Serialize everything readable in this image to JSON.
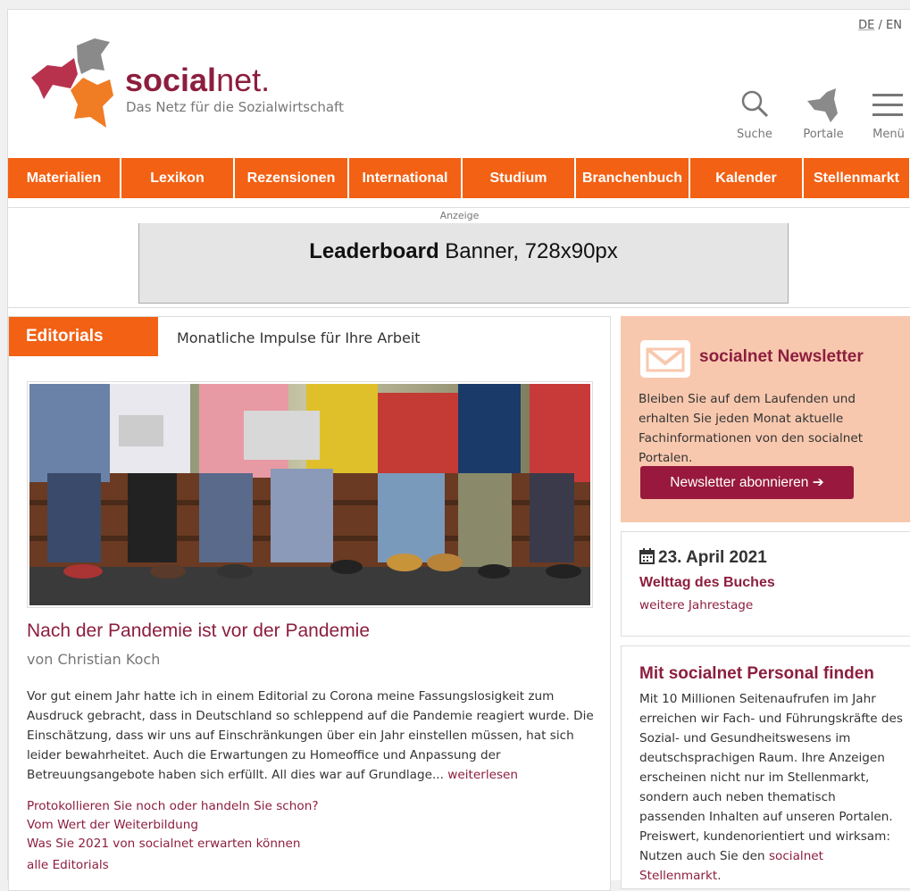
{
  "header": {
    "lang_de": "DE",
    "lang_sep": " / ",
    "lang_en": "EN",
    "brand_social": "social",
    "brand_net": "net.",
    "tagline": "Das Netz für die Sozialwirtschaft",
    "search_label": "Suche",
    "portals_label": "Portale",
    "menu_label": "Menü"
  },
  "nav": {
    "items": [
      "Materialien",
      "Lexikon",
      "Rezensionen",
      "International",
      "Studium",
      "Branchenbuch",
      "Kalender",
      "Stellenmarkt"
    ]
  },
  "ad": {
    "label": "Anzeige",
    "banner_bold": "Leaderboard",
    "banner_rest": " Banner, 728x90px"
  },
  "editorials": {
    "tab": "Editorials",
    "subtitle": "Monatliche Impulse für Ihre Arbeit",
    "title": "Nach der Pandemie ist vor der Pandemie",
    "author": "von Christian Koch",
    "body": "Vor gut einem Jahr hatte ich in einem Editorial zu Corona meine Fassungslosigkeit zum Ausdruck gebracht, dass in Deutschland so schleppend auf die Pandemie reagiert wurde. Die Einschätzung, dass wir uns auf Einschränkungen über ein Jahr einstellen müssen, hat sich leider bewahrheitet. Auch die Erwartungen zu Homeoffice und Anpassung der Betreuungsangebote haben sich erfüllt. All dies war auf Grundlage... ",
    "read_more": "weiterlesen",
    "links": [
      "Protokollieren Sie noch oder handeln Sie schon?",
      "Vom Wert der Weiterbildung",
      "Was Sie 2021 von socialnet erwarten können"
    ],
    "all": "alle Editorials"
  },
  "newsletter": {
    "title": "socialnet Newsletter",
    "text": "Bleiben Sie auf dem Laufenden und erhalten Sie jeden Monat aktuelle Fachinformationen von den socialnet Portalen.",
    "button": "Newsletter abonnieren"
  },
  "day": {
    "date": "23. April 2021",
    "event": "Welttag des Buches",
    "more": "weitere Jahrestage"
  },
  "personal": {
    "title": "Mit socialnet Personal finden",
    "text": "Mit 10 Millionen Seitenaufrufen im Jahr erreichen wir Fach- und Führungskräfte des Sozial- und Gesundheitswesens im deutschsprachigen Raum. Ihre Anzeigen erscheinen nicht nur im Stellenmarkt, sondern auch neben thematisch passenden Inhalten auf unseren Portalen. Preiswert, kundenorientiert und wirksam: Nutzen auch Sie den ",
    "link": "socialnet Stellenmarkt",
    "end": "."
  },
  "colors": {
    "accent": "#f26114",
    "brand": "#8c1e3e",
    "button": "#98193d",
    "newsletter_bg": "#f8c8ae"
  }
}
